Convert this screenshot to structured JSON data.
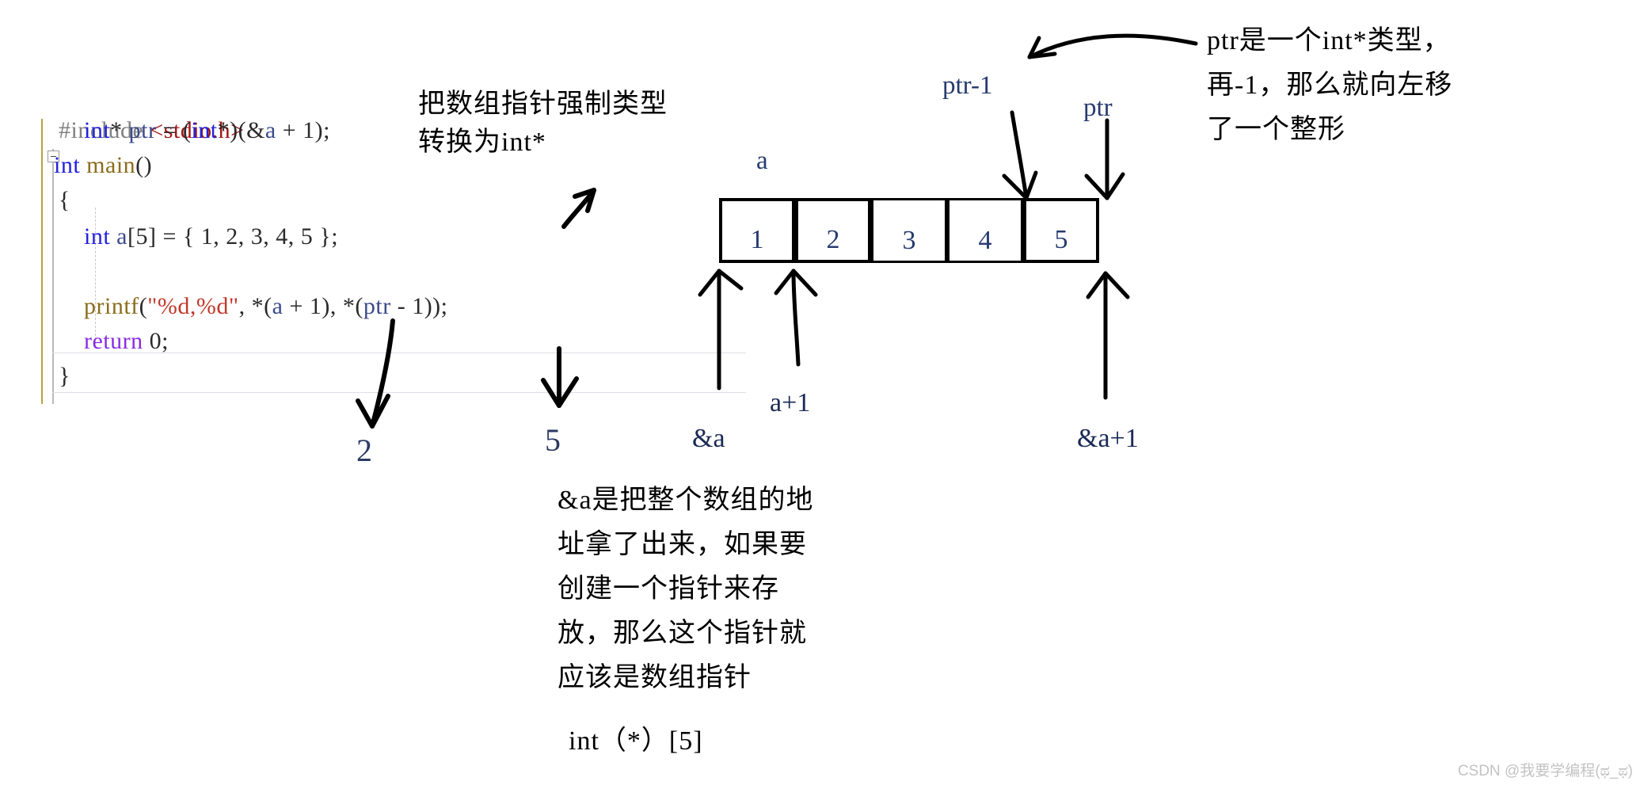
{
  "code": {
    "lines": [
      {
        "id": "include",
        "tokens": [
          {
            "t": "#include ",
            "c": "pre"
          },
          {
            "t": "<stdio.h>",
            "c": "str"
          }
        ]
      },
      {
        "id": "main",
        "tokens": [
          {
            "t": "int",
            "c": "kw"
          },
          {
            "t": " ",
            "c": "plain"
          },
          {
            "t": "main",
            "c": "fn"
          },
          {
            "t": "()",
            "c": "plain"
          }
        ]
      },
      {
        "id": "open-brace",
        "tokens": [
          {
            "t": "{",
            "c": "plain"
          }
        ]
      },
      {
        "id": "array-decl",
        "tokens": [
          {
            "t": "    ",
            "c": "plain"
          },
          {
            "t": "int",
            "c": "kw"
          },
          {
            "t": " ",
            "c": "plain"
          },
          {
            "t": "a",
            "c": "ident"
          },
          {
            "t": "[5] = { 1, 2, 3, 4, 5 };",
            "c": "plain"
          }
        ]
      },
      {
        "id": "ptr-decl",
        "tokens": [
          {
            "t": "    ",
            "c": "plain"
          },
          {
            "t": "int",
            "c": "kw"
          },
          {
            "t": "* ",
            "c": "plain"
          },
          {
            "t": "ptr",
            "c": "ident"
          },
          {
            "t": " = (",
            "c": "plain"
          },
          {
            "t": "int",
            "c": "kw"
          },
          {
            "t": "*)(&",
            "c": "plain"
          },
          {
            "t": "a",
            "c": "ident"
          },
          {
            "t": " + 1);",
            "c": "plain"
          }
        ]
      },
      {
        "id": "printf",
        "tokens": [
          {
            "t": "    ",
            "c": "plain"
          },
          {
            "t": "printf",
            "c": "fn"
          },
          {
            "t": "(",
            "c": "plain"
          },
          {
            "t": "\"%d,%d\"",
            "c": "strred"
          },
          {
            "t": ", *(",
            "c": "plain"
          },
          {
            "t": "a",
            "c": "ident"
          },
          {
            "t": " + 1), *(",
            "c": "plain"
          },
          {
            "t": "ptr",
            "c": "ident"
          },
          {
            "t": " - 1));",
            "c": "plain"
          }
        ]
      },
      {
        "id": "return",
        "tokens": [
          {
            "t": "    ",
            "c": "plain"
          },
          {
            "t": "return",
            "c": "ret"
          },
          {
            "t": " 0;",
            "c": "plain"
          }
        ]
      },
      {
        "id": "close-brace",
        "tokens": [
          {
            "t": "}",
            "c": "plain"
          }
        ]
      }
    ]
  },
  "array": {
    "name_label": "a",
    "cells": [
      {
        "value": "1"
      },
      {
        "value": "2"
      },
      {
        "value": "3"
      },
      {
        "value": "4"
      },
      {
        "value": "5"
      }
    ]
  },
  "pointer_labels": {
    "ptr_minus_1": "ptr-1",
    "ptr": "ptr",
    "amp_a": "&a",
    "a_plus_1": "a+1",
    "amp_a_plus_1": "&a+1"
  },
  "output_labels": {
    "first": "2",
    "second": "5"
  },
  "annotations": {
    "cast_note": {
      "line1": "把数组指针强制类型",
      "line2": "转换为int*"
    },
    "ptr_note": {
      "line1": "ptr是一个int*类型，",
      "line2": "再-1，那么就向左移",
      "line3": "了一个整形"
    },
    "amp_a_note": {
      "line1": "&a是把整个数组的地",
      "line2": "址拿了出来，如果要",
      "line3": "创建一个指针来存",
      "line4": "放，那么这个指针就",
      "line5": "应该是数组指针",
      "type_line": "int（*）[5]"
    }
  },
  "watermark": "CSDN @我要学编程(ಥ_ಥ)",
  "colors": {
    "keyword": "#2222dd",
    "string": "#c0392b",
    "function": "#8a6d1a",
    "return": "#8a2be2",
    "preprocessor": "#808080",
    "identifier": "#3b4a8c",
    "box_border": "#000000",
    "watermark": "#c3c3c3"
  }
}
